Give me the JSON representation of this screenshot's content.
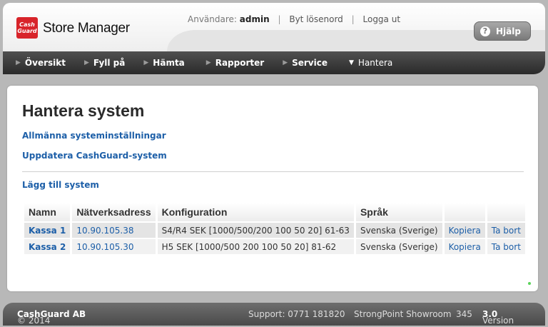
{
  "app": {
    "logo_line1": "Cash",
    "logo_line2": "Guard",
    "title": "Store Manager"
  },
  "userbar": {
    "user_label": "Användare:",
    "user_name": "admin",
    "change_password": "Byt lösenord",
    "logout": "Logga ut",
    "separator": "|"
  },
  "help": {
    "label": "Hjälp",
    "icon": "?"
  },
  "nav": {
    "items": [
      {
        "label": "Översikt",
        "arrow": "▶"
      },
      {
        "label": "Fyll på",
        "arrow": "▶"
      },
      {
        "label": "Hämta",
        "arrow": "▶"
      },
      {
        "label": "Rapporter",
        "arrow": "▶"
      },
      {
        "label": "Service",
        "arrow": "▶"
      },
      {
        "label": "Hantera",
        "arrow": "▼"
      }
    ]
  },
  "main": {
    "title": "Hantera system",
    "link_general": "Allmänna systeminställningar",
    "link_update": "Uppdatera CashGuard-system",
    "link_add": "Lägg till system",
    "table": {
      "headers": [
        "Namn",
        "Nätverksadress",
        "Konfiguration",
        "Språk",
        "",
        ""
      ],
      "rows": [
        {
          "name": "Kassa 1",
          "address": "10.90.105.38",
          "config": "S4/R4 SEK [1000/500/200 100 50 20] 61-63",
          "language": "Svenska (Sverige)",
          "copy": "Kopiera",
          "remove": "Ta bort"
        },
        {
          "name": "Kassa 2",
          "address": "10.90.105.30",
          "config": "H5 SEK [1000/500 200 100 50 20] 81-62",
          "language": "Svenska (Sverige)",
          "copy": "Kopiera",
          "remove": "Ta bort"
        }
      ]
    }
  },
  "footer": {
    "copyright_prefix": "© 2014",
    "company": "CashGuard AB",
    "support": "Support: 0771 181820",
    "store": "StrongPoint Showroom",
    "store_number": "345",
    "version_label": "Version",
    "version": "3.0"
  }
}
